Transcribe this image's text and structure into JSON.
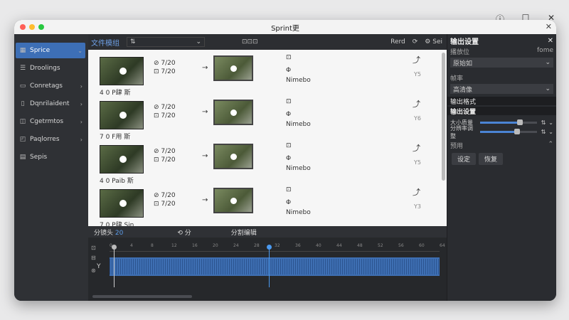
{
  "os": {
    "info_icon": "info-icon",
    "restore_icon": "restore-icon",
    "close_icon": "close-icon"
  },
  "window": {
    "title": "Sprint更"
  },
  "sidebar": {
    "items": [
      {
        "label": "Sprice",
        "active": true
      },
      {
        "label": "Droolings",
        "active": false
      },
      {
        "label": "Conretags",
        "active": false
      },
      {
        "label": "Dqnrilaident",
        "active": false
      },
      {
        "label": "Cgetrmtos",
        "active": false
      },
      {
        "label": "Paqlorres",
        "active": false
      },
      {
        "label": "Sepis",
        "active": false
      }
    ]
  },
  "toolbar": {
    "title": "文件模组",
    "sort_value": "⇅",
    "label": "⊡⊡⊡",
    "btn1": "Rerd",
    "btn2": "Sei"
  },
  "rows": [
    {
      "caption": "4 0 P肆 斯",
      "info1": "⊘ 7/20",
      "info2": "⊡ 7/20",
      "mid_top": "⊡",
      "mid_mid": "Φ",
      "mid_bot": "Nimebo",
      "right": "Y5"
    },
    {
      "caption": "7 0 F用 斯",
      "info1": "⊘ 7/20",
      "info2": "⊡ 7/20",
      "mid_top": "⊡",
      "mid_mid": "Φ",
      "mid_bot": "Nimebo",
      "right": "Y6"
    },
    {
      "caption": "4 0 Paib 斯",
      "info1": "⊘ 7/20",
      "info2": "⊡ 7/20",
      "mid_top": "⊡",
      "mid_mid": "Φ",
      "mid_bot": "Nimebo",
      "right": "Y5"
    },
    {
      "caption": "7 0 P肆 Sin",
      "info1": "⊘ 7/20",
      "info2": "⊡ 7/20",
      "mid_top": "⊡",
      "mid_mid": "Φ",
      "mid_bot": "Nimebo",
      "right": "Y3"
    }
  ],
  "rpanel": {
    "header": "输出设置",
    "sub1_left": "播放位",
    "sub1_right": "fome",
    "input1": "原始如",
    "sub2": "帧率",
    "input2": "高清像",
    "bar1": "输出格式",
    "bar2": "输出设置",
    "slider1_label": "大小质量",
    "slider1_value": 0.7,
    "slider2_label": "分辨率调整",
    "slider2_value": 0.65,
    "section": "预用",
    "btn_a": "设定",
    "btn_b": "恢复"
  },
  "timeline": {
    "tab1": "分镜头",
    "tab1_num": "20",
    "tab2": "分",
    "tab3": "分割编辑",
    "ticks": [
      "0",
      "4",
      "8",
      "12",
      "16",
      "20",
      "24",
      "28",
      "32",
      "36",
      "40",
      "44",
      "48",
      "52",
      "56",
      "60",
      "64"
    ],
    "track_label": "Y"
  }
}
